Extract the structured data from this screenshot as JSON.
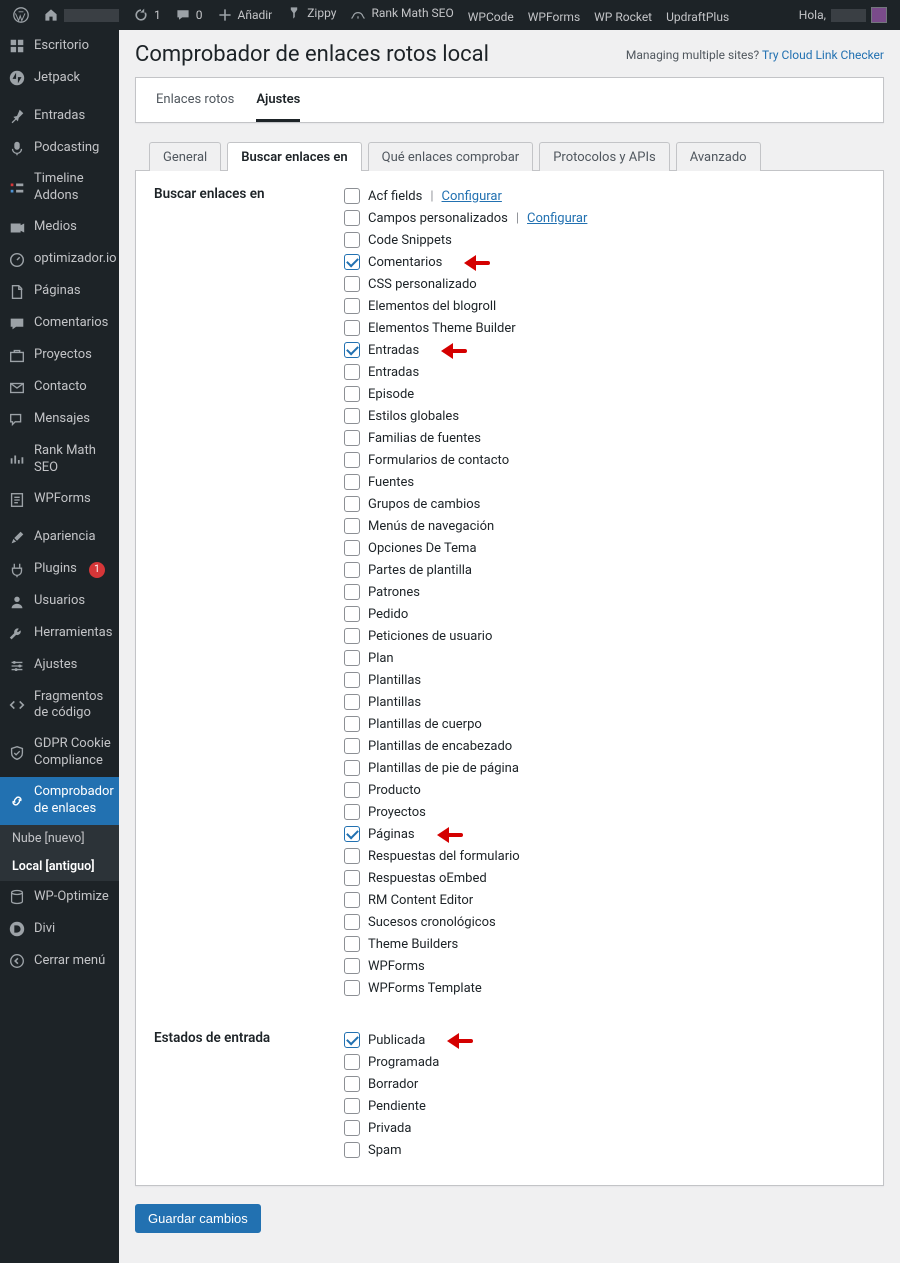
{
  "adminbar": {
    "updates_count": "1",
    "comments_count": "0",
    "add": "Añadir",
    "items": [
      "Zippy",
      "Rank Math SEO",
      "WPCode",
      "WPForms",
      "WP Rocket",
      "UpdraftPlus"
    ],
    "greeting": "Hola,"
  },
  "sidebar": {
    "items": [
      {
        "icon": "dashboard",
        "label": "Escritorio"
      },
      {
        "icon": "jetpack",
        "label": "Jetpack"
      },
      {
        "icon": "pin",
        "label": "Entradas"
      },
      {
        "icon": "mic",
        "label": "Podcasting"
      },
      {
        "icon": "timeline",
        "label": "Timeline Addons"
      },
      {
        "icon": "media",
        "label": "Medios"
      },
      {
        "icon": "gauge",
        "label": "optimizador.io"
      },
      {
        "icon": "page",
        "label": "Páginas"
      },
      {
        "icon": "comment",
        "label": "Comentarios"
      },
      {
        "icon": "portfolio",
        "label": "Proyectos"
      },
      {
        "icon": "mail",
        "label": "Contacto"
      },
      {
        "icon": "chat",
        "label": "Mensajes"
      },
      {
        "icon": "chart",
        "label": "Rank Math SEO"
      },
      {
        "icon": "form",
        "label": "WPForms"
      },
      {
        "icon": "brush",
        "label": "Apariencia"
      },
      {
        "icon": "plug",
        "label": "Plugins",
        "badge": "1"
      },
      {
        "icon": "user",
        "label": "Usuarios"
      },
      {
        "icon": "wrench",
        "label": "Herramientas"
      },
      {
        "icon": "sliders",
        "label": "Ajustes"
      },
      {
        "icon": "code",
        "label": "Fragmentos de código"
      },
      {
        "icon": "shield",
        "label": "GDPR Cookie Compliance"
      },
      {
        "icon": "link",
        "label": "Comprobador de enlaces",
        "current": true
      },
      {
        "icon": "db",
        "label": "WP-Optimize"
      },
      {
        "icon": "divi",
        "label": "Divi"
      },
      {
        "icon": "collapse",
        "label": "Cerrar menú"
      }
    ],
    "submenu": [
      {
        "label": "Nube [nuevo]"
      },
      {
        "label": "Local [antiguo]",
        "current": true
      }
    ]
  },
  "page": {
    "title": "Comprobador de enlaces rotos local",
    "managing_sites": "Managing multiple sites?",
    "try_cloud": "Try Cloud Link Checker",
    "local_tabs": {
      "broken": "Enlaces rotos",
      "settings": "Ajustes"
    },
    "settings_tabs": [
      "General",
      "Buscar enlaces en",
      "Qué enlaces comprobar",
      "Protocolos y APIs",
      "Avanzado"
    ],
    "active_settings_tab": 1
  },
  "form": {
    "section1_heading": "Buscar enlaces en",
    "section2_heading": "Estados de entrada",
    "configure_link": "Configurar",
    "options": [
      {
        "label": "Acf fields",
        "checked": false,
        "configure": true
      },
      {
        "label": "Campos personalizados",
        "checked": false,
        "configure": true
      },
      {
        "label": "Code Snippets",
        "checked": false
      },
      {
        "label": "Comentarios",
        "checked": true,
        "arrow": true
      },
      {
        "label": "CSS personalizado",
        "checked": false
      },
      {
        "label": "Elementos del blogroll",
        "checked": false
      },
      {
        "label": "Elementos Theme Builder",
        "checked": false
      },
      {
        "label": "Entradas",
        "checked": true,
        "arrow": true
      },
      {
        "label": "Entradas",
        "checked": false
      },
      {
        "label": "Episode",
        "checked": false
      },
      {
        "label": "Estilos globales",
        "checked": false
      },
      {
        "label": "Familias de fuentes",
        "checked": false
      },
      {
        "label": "Formularios de contacto",
        "checked": false
      },
      {
        "label": "Fuentes",
        "checked": false
      },
      {
        "label": "Grupos de cambios",
        "checked": false
      },
      {
        "label": "Menús de navegación",
        "checked": false
      },
      {
        "label": "Opciones De Tema",
        "checked": false
      },
      {
        "label": "Partes de plantilla",
        "checked": false
      },
      {
        "label": "Patrones",
        "checked": false
      },
      {
        "label": "Pedido",
        "checked": false
      },
      {
        "label": "Peticiones de usuario",
        "checked": false
      },
      {
        "label": "Plan",
        "checked": false
      },
      {
        "label": "Plantillas",
        "checked": false
      },
      {
        "label": "Plantillas",
        "checked": false
      },
      {
        "label": "Plantillas de cuerpo",
        "checked": false
      },
      {
        "label": "Plantillas de encabezado",
        "checked": false
      },
      {
        "label": "Plantillas de pie de página",
        "checked": false
      },
      {
        "label": "Producto",
        "checked": false
      },
      {
        "label": "Proyectos",
        "checked": false
      },
      {
        "label": "Páginas",
        "checked": true,
        "arrow": true
      },
      {
        "label": "Respuestas del formulario",
        "checked": false
      },
      {
        "label": "Respuestas oEmbed",
        "checked": false
      },
      {
        "label": "RM Content Editor",
        "checked": false
      },
      {
        "label": "Sucesos cronológicos",
        "checked": false
      },
      {
        "label": "Theme Builders",
        "checked": false
      },
      {
        "label": "WPForms",
        "checked": false
      },
      {
        "label": "WPForms Template",
        "checked": false
      }
    ],
    "statuses": [
      {
        "label": "Publicada",
        "checked": true,
        "arrow": true
      },
      {
        "label": "Programada",
        "checked": false
      },
      {
        "label": "Borrador",
        "checked": false
      },
      {
        "label": "Pendiente",
        "checked": false
      },
      {
        "label": "Privada",
        "checked": false
      },
      {
        "label": "Spam",
        "checked": false
      }
    ],
    "save_label": "Guardar cambios"
  }
}
